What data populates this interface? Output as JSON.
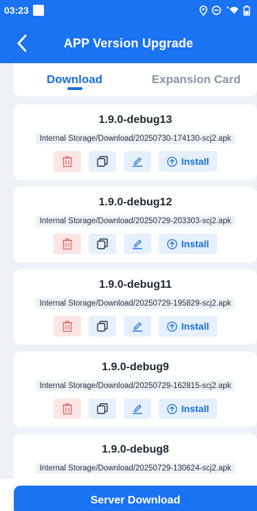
{
  "status_bar": {
    "time": "03:23",
    "icons": [
      "location-icon",
      "dnd-icon",
      "wifi-icon",
      "battery-icon"
    ]
  },
  "header": {
    "title": "APP Version Upgrade",
    "back_icon": "back-arrow-icon"
  },
  "tabs": [
    {
      "label": "Download",
      "active": true
    },
    {
      "label": "Expansion Card",
      "active": false
    }
  ],
  "files": [
    {
      "version": "1.9.0-debug13",
      "path": "Internal Storage/Download/20250730-174130-scj2.apk"
    },
    {
      "version": "1.9.0-debug12",
      "path": "Internal Storage/Download/20250729-203303-scj2.apk"
    },
    {
      "version": "1.9.0-debug11",
      "path": "Internal Storage/Download/20250729-195829-scj2.apk"
    },
    {
      "version": "1.9.0-debug9",
      "path": "Internal Storage/Download/20250729-162815-scj2.apk"
    },
    {
      "version": "1.9.0-debug8",
      "path": "Internal Storage/Download/20250729-130624-scj2.apk"
    }
  ],
  "actions": {
    "install_label": "Install",
    "icons": [
      "trash-icon",
      "copy-icon",
      "edit-icon",
      "upload-circle-icon"
    ]
  },
  "footer": {
    "server_download_label": "Server Download"
  },
  "colors": {
    "primary": "#1a73f0",
    "tab_active": "#1a6fe0",
    "tab_inactive": "#8a95a5",
    "delete_bg": "#fbe5e5",
    "delete_icon": "#e36b6b",
    "action_bg": "#e6effc",
    "page_bg": "#eef2f7"
  }
}
